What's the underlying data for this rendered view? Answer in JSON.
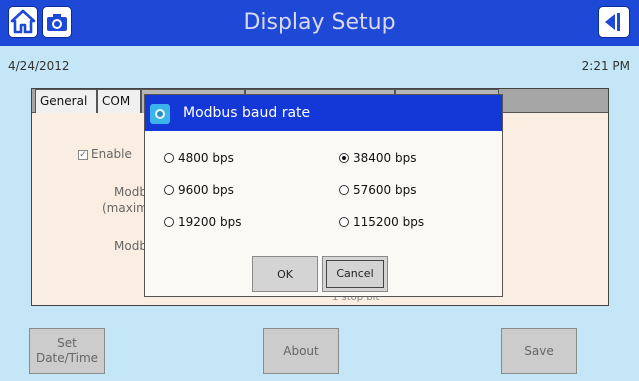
{
  "header": {
    "title": "Display Setup",
    "home_icon": "home-icon",
    "camera_icon": "camera-icon",
    "back_icon": "back-arrow-icon",
    "accent_color": "#1e49d6"
  },
  "status": {
    "date": "4/24/2012",
    "time": "2:21 PM"
  },
  "tabs": [
    "General",
    "COM"
  ],
  "background_panel": {
    "enable_label": "Enable",
    "modbus_label_1": "Modbus",
    "modbus_label_1b": "(maximu",
    "modbus_label_2": "Modbus",
    "stop_bit": "1 stop bit"
  },
  "dialog": {
    "title": "Modbus baud rate",
    "options": [
      {
        "label": "4800 bps",
        "selected": false
      },
      {
        "label": "9600 bps",
        "selected": false
      },
      {
        "label": "19200 bps",
        "selected": false
      },
      {
        "label": "38400 bps",
        "selected": true
      },
      {
        "label": "57600 bps",
        "selected": false
      },
      {
        "label": "115200 bps",
        "selected": false
      }
    ],
    "ok_label": "OK",
    "cancel_label": "Cancel"
  },
  "footer": {
    "set_date_line1": "Set",
    "set_date_line2": "Date/Time",
    "about_label": "About",
    "save_label": "Save"
  }
}
